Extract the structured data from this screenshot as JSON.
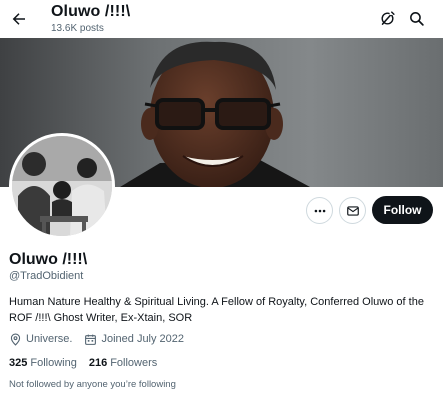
{
  "header": {
    "title": "Oluwo /!!!\\",
    "posts": "13.6K posts",
    "back_icon": "arrow-left-icon",
    "grok_icon": "grok-icon",
    "search_icon": "search-icon"
  },
  "profile": {
    "display_name": "Oluwo /!!!\\",
    "handle": "@TradObidient",
    "bio": "Human Nature Healthy & Spiritual Living. A Fellow of Royalty, Conferred Oluwo of the ROF /!!!\\ Ghost Writer, Ex-Xtain, SOR",
    "location": "Universe.",
    "joined": "Joined July 2022",
    "following_count": "325",
    "following_label": "Following",
    "followers_count": "216",
    "followers_label": "Followers",
    "not_followed_note": "Not followed by anyone you’re following"
  },
  "actions": {
    "more_icon": "more-icon",
    "message_icon": "message-icon",
    "follow_label": "Follow"
  },
  "colors": {
    "text_primary": "#0f1419",
    "text_secondary": "#536471",
    "follow_bg": "#0f1419",
    "button_border": "#cfd9de"
  }
}
